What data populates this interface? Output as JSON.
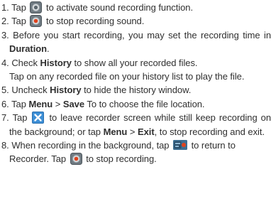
{
  "steps": [
    {
      "num": "1.",
      "before": "Tap",
      "icon": "record-start-icon",
      "after": "to activate sound recording function."
    },
    {
      "num": "2.",
      "before": "Tap",
      "icon": "record-stop-icon",
      "after": "to stop recording sound."
    },
    {
      "num": "3.",
      "before": "Before you start recording, you may set the recording time in",
      "bold": "Duration",
      "after": "."
    },
    {
      "num": "4.",
      "before": "Check",
      "bold": "History",
      "after": "to show all your recorded files.",
      "continuation": "Tap on any recorded file on your history list to play the file."
    },
    {
      "num": "5.",
      "before": "Uncheck",
      "bold": "History",
      "after": "to hide the history window."
    },
    {
      "num": "6.",
      "before": "Tap",
      "bold1": "Menu",
      "mid": ">",
      "bold2": "Save",
      "after": "To to choose the file location."
    },
    {
      "num": "7.",
      "before": "Tap",
      "icon": "close-x-icon",
      "after1": "to leave recorder screen while still keep recording on the background; or tap",
      "bold1": "Menu",
      "mid": ">",
      "bold2": "Exit",
      "after2": ", to stop recording and exit."
    },
    {
      "num": "8.",
      "before": "When recording in the background, tap",
      "icon": "recorder-app-icon",
      "after1": "to return to Recorder. Tap",
      "icon2": "record-stop-icon",
      "after2": "to stop recording."
    }
  ],
  "colors": {
    "text": "#2f2f2f",
    "close_icon": "#3d8fd6",
    "record_dot": "#e0431e"
  }
}
